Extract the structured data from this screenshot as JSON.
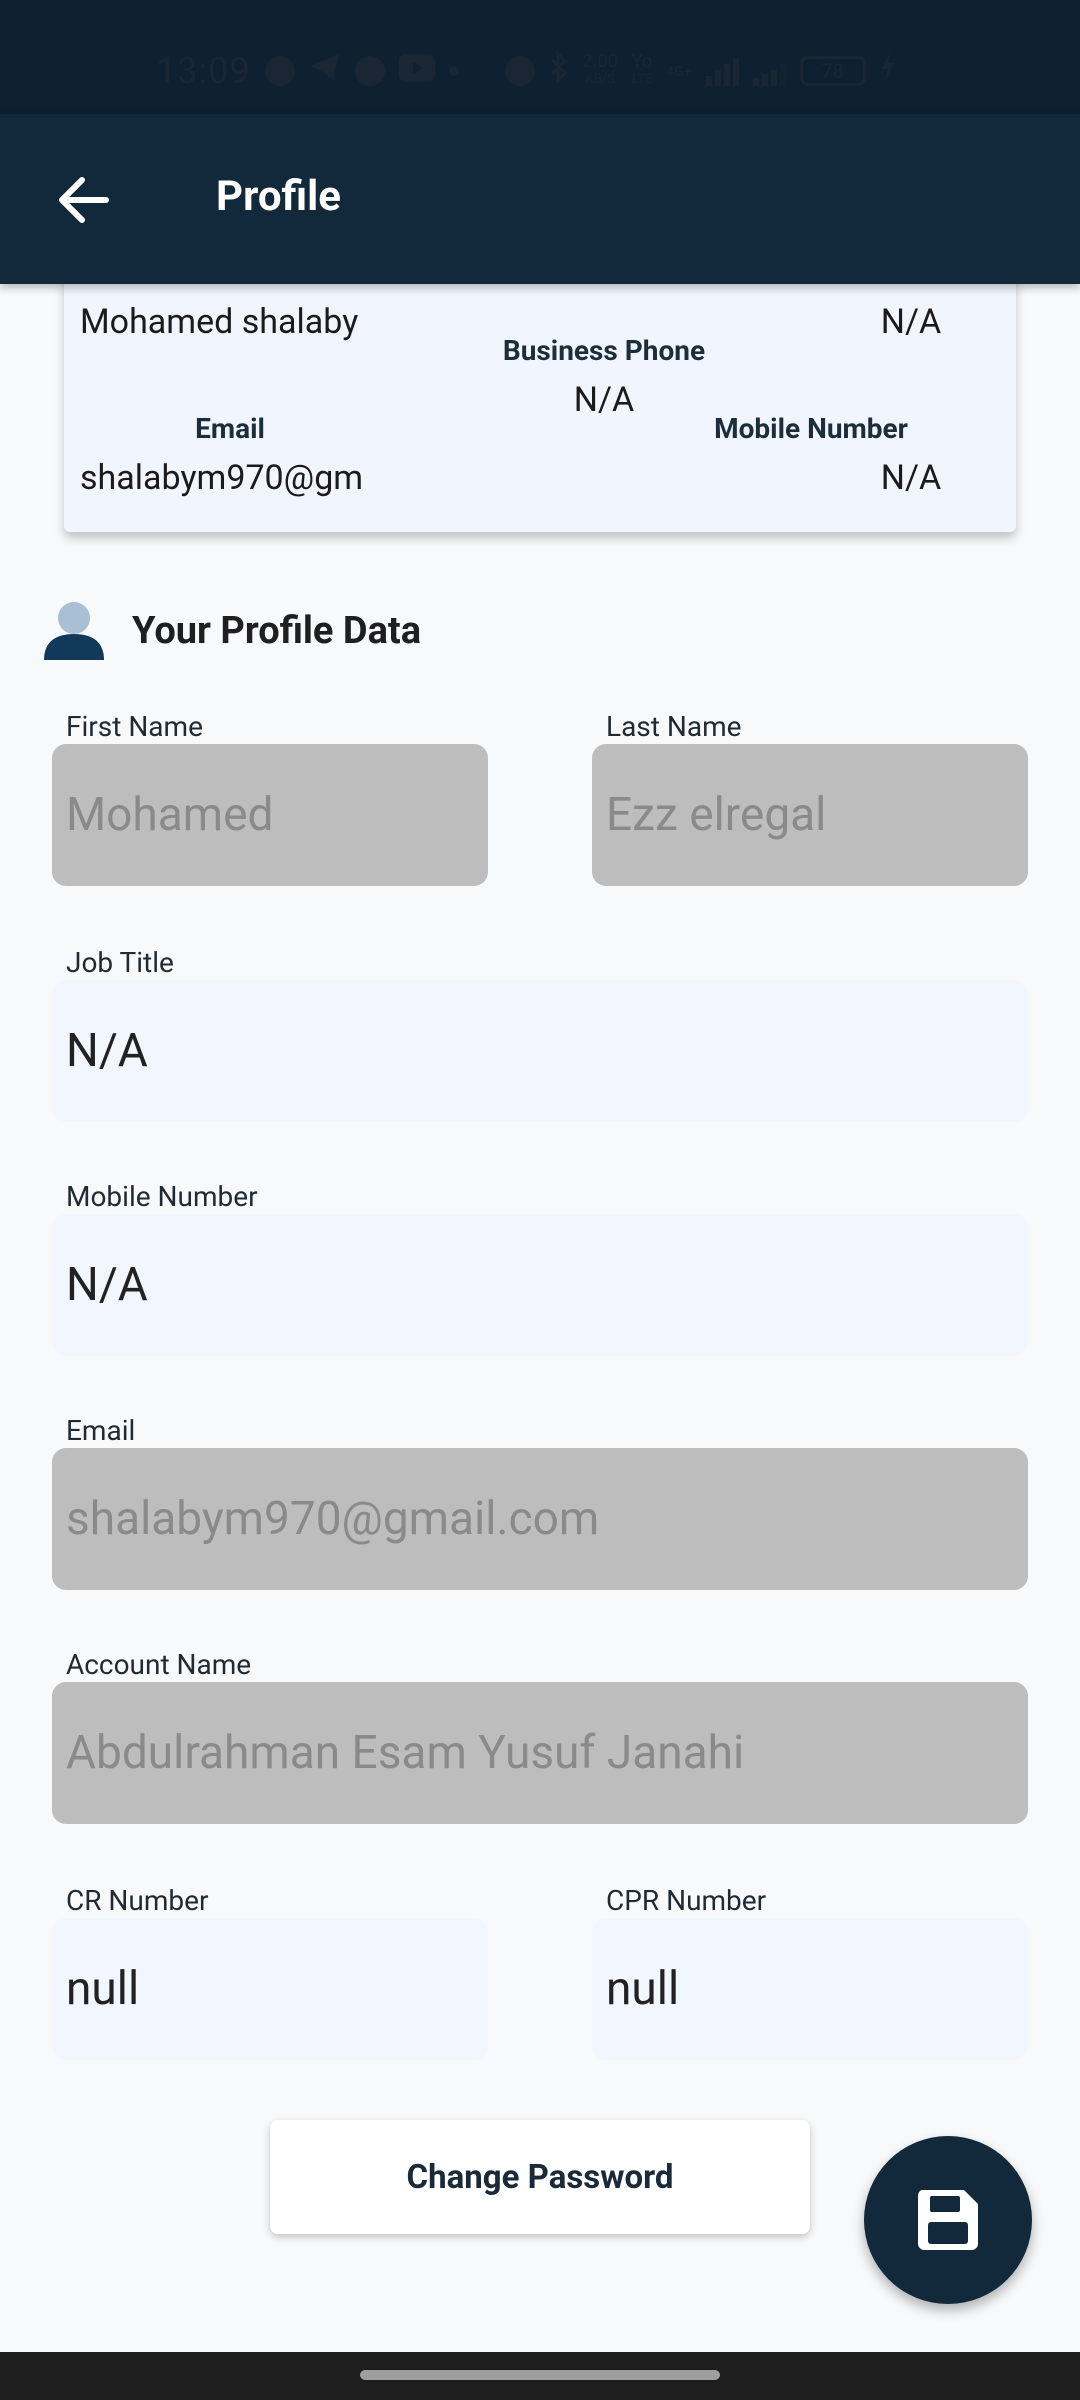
{
  "status_bar": {
    "time": "13:09",
    "net_speed_top": "2.00",
    "net_speed_unit": "KB/S",
    "volte_top": "Yo",
    "volte_bottom": "LTE",
    "net_type": "4G+",
    "battery": "78"
  },
  "app_bar": {
    "title": "Profile",
    "back_icon": "arrow-left-icon"
  },
  "summary": {
    "name": "Mohamed shalaby",
    "top_right_value": "N/A",
    "business_phone_label": "Business Phone",
    "business_phone_value": "N/A",
    "email_label": "Email",
    "email_value": "shalabym970@gm",
    "mobile_label": "Mobile Number",
    "mobile_value": "N/A"
  },
  "section": {
    "icon": "person-icon",
    "title": "Your Profile Data"
  },
  "form": {
    "first_name_label": "First Name",
    "first_name_value": "Mohamed",
    "last_name_label": "Last Name",
    "last_name_value": "Ezz elregal",
    "job_title_label": "Job Title",
    "job_title_value": "N/A",
    "mobile_label": "Mobile Number",
    "mobile_value": "N/A",
    "email_label": "Email",
    "email_value": "shalabym970@gmail.com",
    "account_name_label": "Account Name",
    "account_name_value": "Abdulrahman Esam Yusuf Janahi",
    "cr_label": "CR Number",
    "cr_value": "null",
    "cpr_label": "CPR Number",
    "cpr_value": "null"
  },
  "actions": {
    "change_password_label": "Change Password",
    "save_icon": "floppy-disk-icon"
  },
  "colors": {
    "primary": "#12293b",
    "card_bg": "#f1f5fd",
    "disabled_field": "#bdbdbd",
    "enabled_field": "#f2f6ff"
  }
}
